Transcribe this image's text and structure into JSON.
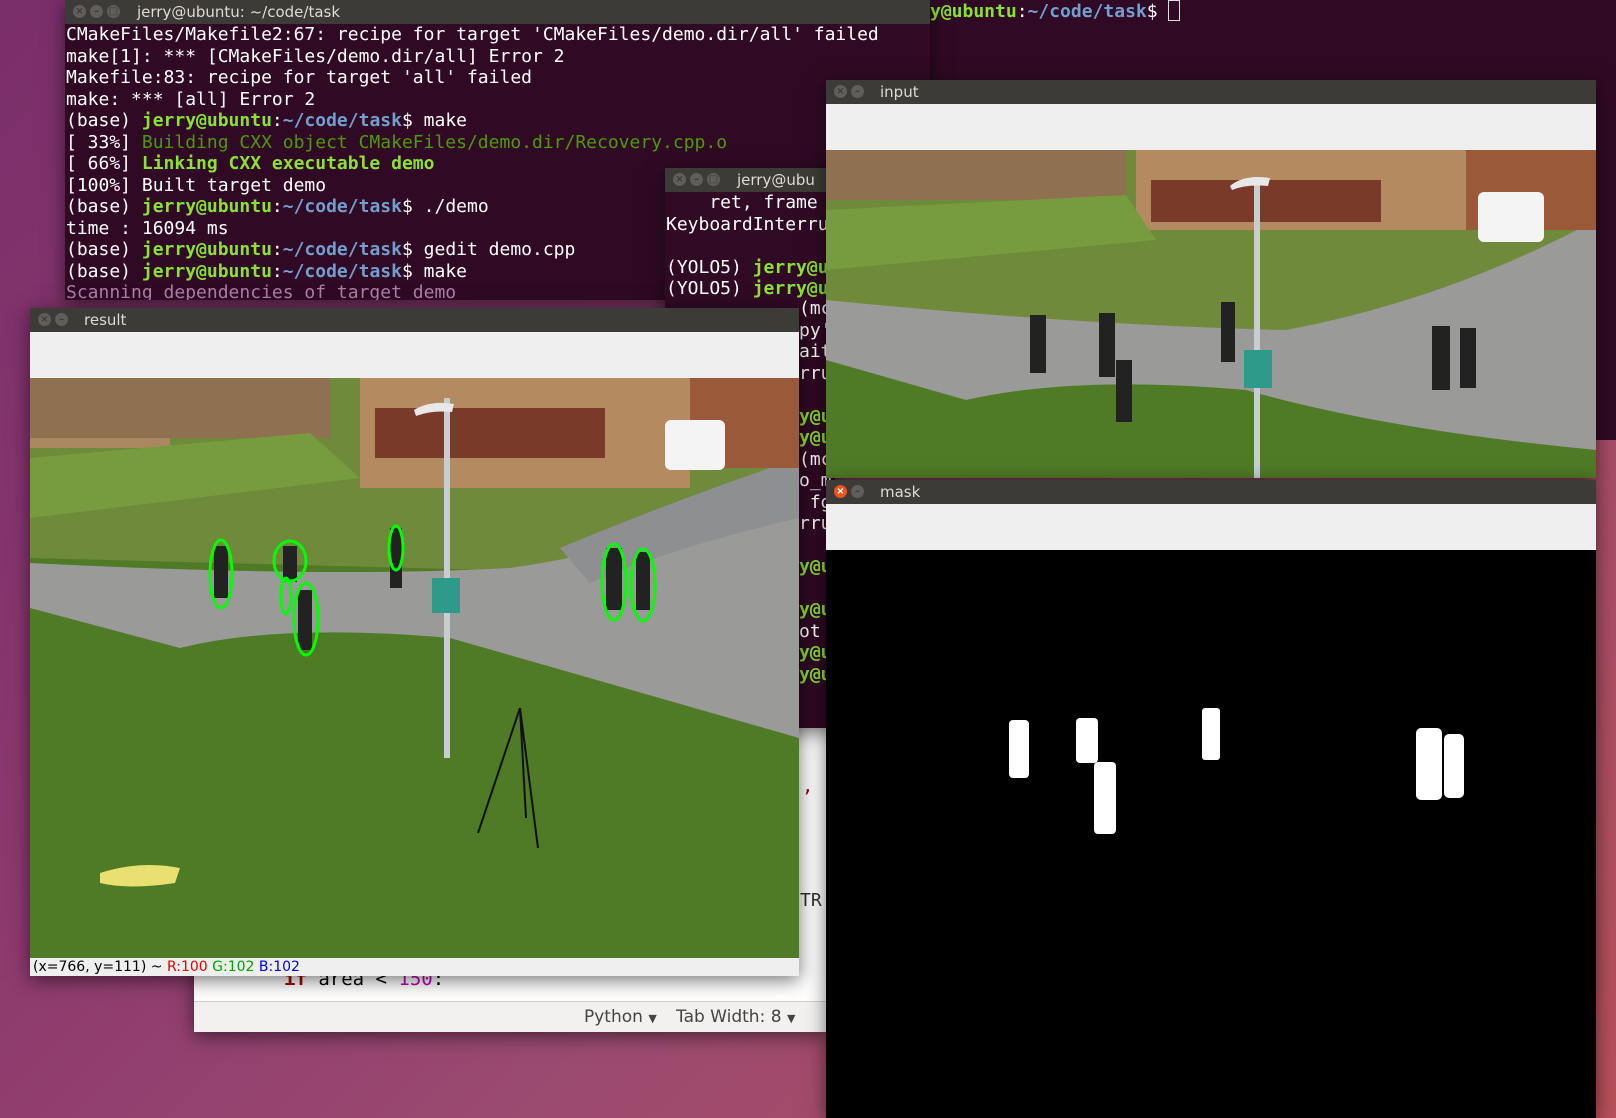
{
  "top_terminal": {
    "title": "jerry@ubuntu: ~/code/task",
    "lines": [
      [
        {
          "t": "CMakeFiles/Makefile2:67: recipe for target 'CMakeFiles/demo.dir/all' failed",
          "c": ""
        }
      ],
      [
        {
          "t": "make[1]: *** [CMakeFiles/demo.dir/all] Error 2",
          "c": ""
        }
      ],
      [
        {
          "t": "Makefile:83: recipe for target 'all' failed",
          "c": ""
        }
      ],
      [
        {
          "t": "make: *** [all] Error 2",
          "c": ""
        }
      ],
      [
        {
          "t": "(base) ",
          "c": ""
        },
        {
          "t": "jerry@ubuntu",
          "c": "g"
        },
        {
          "t": ":",
          "c": ""
        },
        {
          "t": "~/code/task",
          "c": "bl"
        },
        {
          "t": "$ make",
          "c": ""
        }
      ],
      [
        {
          "t": "[ 33%] ",
          "c": ""
        },
        {
          "t": "Building CXX object CMakeFiles/demo.dir/Recovery.cpp.o",
          "c": "gr"
        }
      ],
      [
        {
          "t": "[ 66%] ",
          "c": ""
        },
        {
          "t": "Linking CXX executable demo",
          "c": "g"
        }
      ],
      [
        {
          "t": "[100%] Built target demo",
          "c": ""
        }
      ],
      [
        {
          "t": "(base) ",
          "c": ""
        },
        {
          "t": "jerry@ubuntu",
          "c": "g"
        },
        {
          "t": ":",
          "c": ""
        },
        {
          "t": "~/code/task",
          "c": "bl"
        },
        {
          "t": "$ ./demo",
          "c": ""
        }
      ],
      [
        {
          "t": "time : 16094 ms",
          "c": ""
        }
      ],
      [
        {
          "t": "(base) ",
          "c": ""
        },
        {
          "t": "jerry@ubuntu",
          "c": "g"
        },
        {
          "t": ":",
          "c": ""
        },
        {
          "t": "~/code/task",
          "c": "bl"
        },
        {
          "t": "$ gedit demo.cpp",
          "c": ""
        }
      ],
      [
        {
          "t": "(base) ",
          "c": ""
        },
        {
          "t": "jerry@ubuntu",
          "c": "g"
        },
        {
          "t": ":",
          "c": ""
        },
        {
          "t": "~/code/task",
          "c": "bl"
        },
        {
          "t": "$ make",
          "c": ""
        }
      ],
      [
        {
          "t": "Scanning dependencies of target demo",
          "c": "pu"
        }
      ]
    ]
  },
  "bg_prompt": {
    "user": "y@ubuntu",
    "path": "~/code/task",
    "suffix": "$ "
  },
  "mid_terminal": {
    "title": "jerry@ubu",
    "lines": [
      [
        {
          "t": "    ret, frame",
          "c": ""
        }
      ],
      [
        {
          "t": "KeyboardInterru",
          "c": ""
        }
      ],
      [
        {
          "t": "",
          "c": ""
        }
      ],
      [
        {
          "t": "(YOLO5) ",
          "c": ""
        },
        {
          "t": "jerry@u",
          "c": "g"
        }
      ],
      [
        {
          "t": "(YOLO5) ",
          "c": ""
        },
        {
          "t": "jerry@u",
          "c": "g"
        }
      ]
    ],
    "right_fragments": [
      "(mc",
      "py'",
      "ait",
      "rru",
      "",
      "y@u",
      "y@u",
      "(mc",
      "o_m",
      " fg",
      "rru",
      "",
      "y@u",
      "",
      "y@u",
      "ot",
      "y@u",
      "y@u"
    ]
  },
  "gedit": {
    "code_line_keyword": "if",
    "code_line_var": " area ",
    "code_line_op": "<",
    "code_line_num": " 150",
    "code_line_end": ":",
    "fragment_comma": ",",
    "fragment_tr": "TR",
    "language": "Python",
    "tab_width": "Tab Width: 8"
  },
  "result_window": {
    "title": "result",
    "status_coords": "(x=766, y=111) ~ ",
    "status_r": "R:100",
    "status_g": "G:102",
    "status_b": "B:102"
  },
  "input_window": {
    "title": "input"
  },
  "mask_window": {
    "title": "mask"
  },
  "colors": {
    "terminal_bg": "#300a24",
    "prompt_green": "#8ae234",
    "path_blue": "#729fcf",
    "detection_ellipse": "#00ff00",
    "status_red": "#e00000",
    "status_green": "#00a000",
    "status_blue": "#0000e0"
  }
}
